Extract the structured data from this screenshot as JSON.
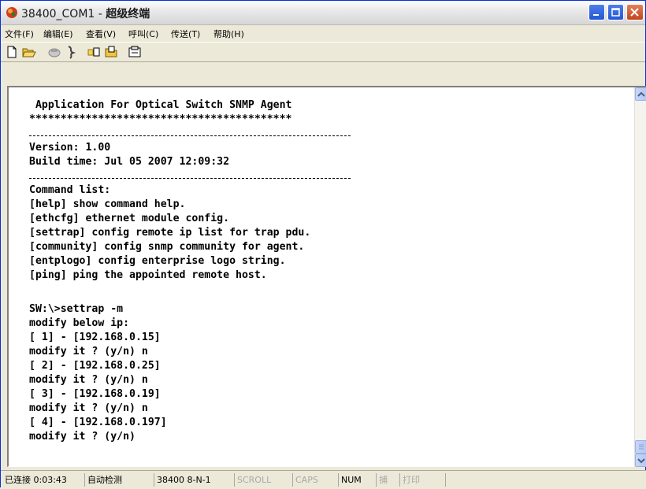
{
  "window": {
    "title_prefix": "38400_COM1 - ",
    "title_app": "超级终端"
  },
  "menu": [
    "文件(F)",
    "编辑(E)",
    "查看(V)",
    "呼叫(C)",
    "传送(T)",
    "帮助(H)"
  ],
  "toolbar": {
    "icons": [
      "new-icon",
      "open-icon",
      "call-icon",
      "disconnect-icon",
      "send-icon",
      "receive-icon",
      "properties-icon"
    ]
  },
  "terminal": {
    "lines": [
      " Application For Optical Switch SNMP Agent",
      "******************************************",
      "Version: 1.00",
      "Build time: Jul 05 2007 12:09:32",
      "Command list:",
      "[help] show command help.",
      "[ethcfg] ethernet module config.",
      "[settrap] config remote ip list for trap pdu.",
      "[community] config snmp community for agent.",
      "[entplogo] config enterprise logo string.",
      "[ping] ping the appointed remote host.",
      "SW:\\>settrap -m",
      "modify below ip:",
      "[ 1] - [192.168.0.15]",
      "modify it ? (y/n) n",
      "[ 2] - [192.168.0.25]",
      "modify it ? (y/n) n",
      "[ 3] - [192.168.0.19]",
      "modify it ? (y/n) n",
      "[ 4] - [192.168.0.197]",
      "modify it ? (y/n)"
    ]
  },
  "status": {
    "connected": "已连接 0:03:43",
    "detect": "自动检测",
    "port": "38400 8-N-1",
    "scroll": "SCROLL",
    "caps": "CAPS",
    "num": "NUM",
    "capture": "捕",
    "print": "打印"
  },
  "colors": {
    "terminal_bg": "#ffffff",
    "terminal_fg": "#000000",
    "chrome": "#ece9d8",
    "close_button": "#c3441c",
    "title_buttons": "#2357d6"
  }
}
